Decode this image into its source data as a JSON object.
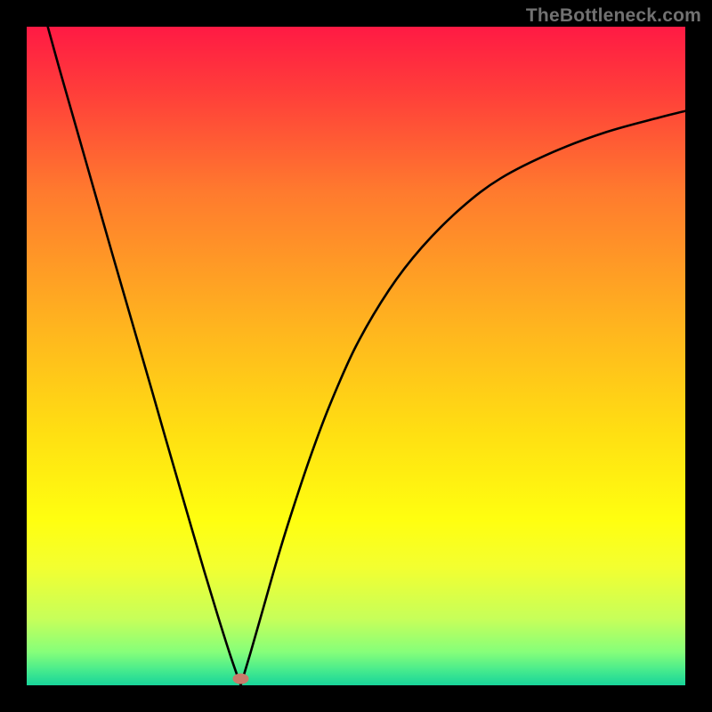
{
  "watermark": "TheBottleneck.com",
  "chart_data": {
    "type": "line",
    "title": "",
    "xlabel": "",
    "ylabel": "",
    "xlim": [
      0,
      1
    ],
    "ylim": [
      0,
      1
    ],
    "background_gradient": {
      "stops": [
        {
          "offset": 0.0,
          "color": "#ff1a44"
        },
        {
          "offset": 0.1,
          "color": "#ff3e3a"
        },
        {
          "offset": 0.25,
          "color": "#ff7a2e"
        },
        {
          "offset": 0.45,
          "color": "#ffb31f"
        },
        {
          "offset": 0.62,
          "color": "#ffe012"
        },
        {
          "offset": 0.75,
          "color": "#ffff10"
        },
        {
          "offset": 0.82,
          "color": "#f3ff30"
        },
        {
          "offset": 0.9,
          "color": "#c6ff5a"
        },
        {
          "offset": 0.95,
          "color": "#85ff7a"
        },
        {
          "offset": 0.98,
          "color": "#40e88f"
        },
        {
          "offset": 1.0,
          "color": "#18d49a"
        }
      ]
    },
    "annotations": [
      {
        "type": "marker",
        "shape": "ellipse",
        "x": 0.325,
        "y": 0.01,
        "color": "#c97b6b"
      }
    ],
    "series": [
      {
        "name": "curve",
        "x": [
          0.032,
          0.05,
          0.07,
          0.09,
          0.11,
          0.13,
          0.15,
          0.17,
          0.19,
          0.21,
          0.23,
          0.25,
          0.27,
          0.29,
          0.31,
          0.325,
          0.34,
          0.36,
          0.38,
          0.4,
          0.43,
          0.46,
          0.5,
          0.55,
          0.6,
          0.66,
          0.72,
          0.8,
          0.88,
          0.96,
          1.0
        ],
        "y": [
          1.0,
          0.935,
          0.865,
          0.795,
          0.725,
          0.655,
          0.586,
          0.517,
          0.448,
          0.378,
          0.309,
          0.24,
          0.172,
          0.106,
          0.043,
          0.0,
          0.05,
          0.12,
          0.19,
          0.255,
          0.345,
          0.425,
          0.515,
          0.6,
          0.665,
          0.725,
          0.77,
          0.81,
          0.84,
          0.862,
          0.872
        ]
      }
    ]
  }
}
